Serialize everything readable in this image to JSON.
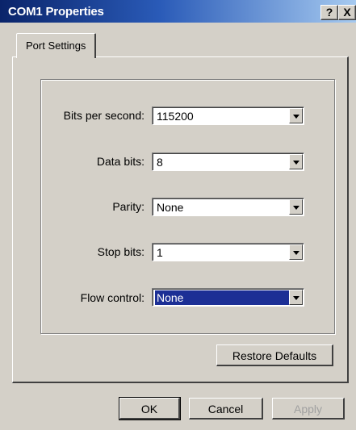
{
  "window": {
    "title": "COM1 Properties"
  },
  "titlebar_buttons": {
    "help": "?",
    "close": "X"
  },
  "tabs": [
    {
      "label": "Port Settings"
    }
  ],
  "fields": {
    "bits_per_second": {
      "label": "Bits per second:",
      "value": "115200"
    },
    "data_bits": {
      "label": "Data bits:",
      "value": "8"
    },
    "parity": {
      "label": "Parity:",
      "value": "None"
    },
    "stop_bits": {
      "label": "Stop bits:",
      "value": "1"
    },
    "flow_control": {
      "label": "Flow control:",
      "value": "None"
    }
  },
  "buttons": {
    "restore_defaults": "Restore Defaults",
    "ok": "OK",
    "cancel": "Cancel",
    "apply": "Apply"
  },
  "colors": {
    "title_bar": "#0a246a",
    "selection": "#1c2f95",
    "face": "#d4d0c8"
  }
}
